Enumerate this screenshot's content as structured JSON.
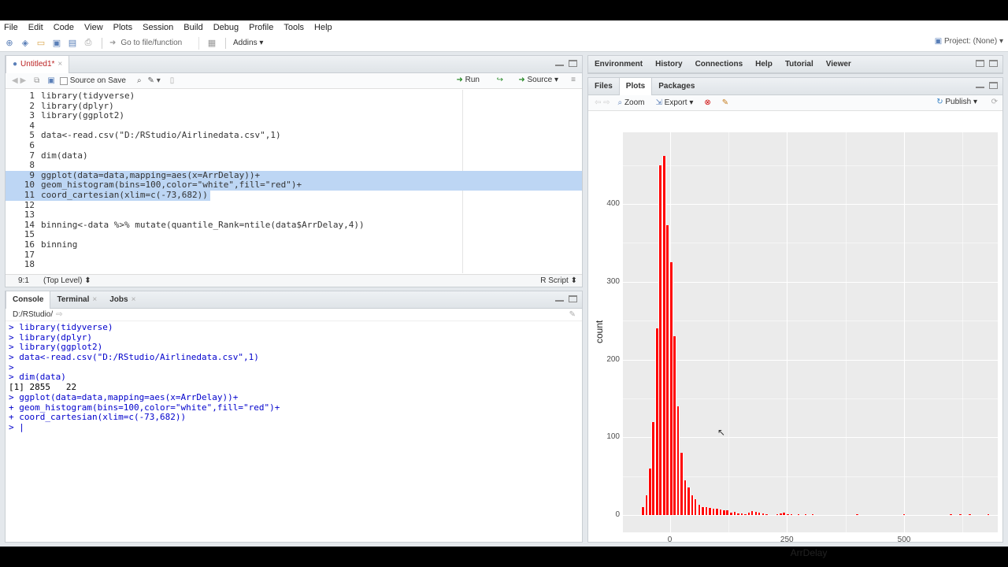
{
  "menu": [
    "File",
    "Edit",
    "Code",
    "View",
    "Plots",
    "Session",
    "Build",
    "Debug",
    "Profile",
    "Tools",
    "Help"
  ],
  "toolbar": {
    "goto_placeholder": "Go to file/function",
    "addins": "Addins",
    "project": "Project: (None)"
  },
  "source": {
    "tab_label": "Untitled1*",
    "source_on_save": "Source on Save",
    "run": "Run",
    "source": "Source",
    "cursor_pos": "9:1",
    "scope": "(Top Level)",
    "file_type": "R Script",
    "lines": [
      {
        "n": "1",
        "text": "library(tidyverse)"
      },
      {
        "n": "2",
        "text": "library(dplyr)"
      },
      {
        "n": "3",
        "text": "library(ggplot2)"
      },
      {
        "n": "4",
        "text": ""
      },
      {
        "n": "5",
        "text": "data<-read.csv(\"D:/RStudio/Airlinedata.csv\",1)"
      },
      {
        "n": "6",
        "text": ""
      },
      {
        "n": "7",
        "text": "dim(data)"
      },
      {
        "n": "8",
        "text": ""
      },
      {
        "n": "9",
        "text": "ggplot(data=data,mapping=aes(x=ArrDelay))+"
      },
      {
        "n": "10",
        "text": "geom_histogram(bins=100,color=\"white\",fill=\"red\")+"
      },
      {
        "n": "11",
        "text": "coord_cartesian(xlim=c(-73,682))"
      },
      {
        "n": "12",
        "text": ""
      },
      {
        "n": "13",
        "text": ""
      },
      {
        "n": "14",
        "text": "binning<-data %>% mutate(quantile_Rank=ntile(data$ArrDelay,4))"
      },
      {
        "n": "15",
        "text": ""
      },
      {
        "n": "16",
        "text": "binning"
      },
      {
        "n": "17",
        "text": ""
      },
      {
        "n": "18",
        "text": ""
      }
    ]
  },
  "console": {
    "tabs": [
      "Console",
      "Terminal",
      "Jobs"
    ],
    "path": "D:/RStudio/",
    "lines": [
      {
        "text": "> library(tidyverse)",
        "kind": "cmd"
      },
      {
        "text": "> library(dplyr)",
        "kind": "cmd"
      },
      {
        "text": "> library(ggplot2)",
        "kind": "cmd"
      },
      {
        "text": "> data<-read.csv(\"D:/RStudio/Airlinedata.csv\",1)",
        "kind": "cmd"
      },
      {
        "text": ">",
        "kind": "cmd"
      },
      {
        "text": "> dim(data)",
        "kind": "cmd"
      },
      {
        "text": "[1] 2855   22",
        "kind": "out"
      },
      {
        "text": "> ggplot(data=data,mapping=aes(x=ArrDelay))+",
        "kind": "cmd"
      },
      {
        "text": "+ geom_histogram(bins=100,color=\"white\",fill=\"red\")+",
        "kind": "cmd"
      },
      {
        "text": "+ coord_cartesian(xlim=c(-73,682))",
        "kind": "cmd"
      },
      {
        "text": "> |",
        "kind": "cmd"
      }
    ]
  },
  "env_tabs": [
    "Environment",
    "History",
    "Connections",
    "Help",
    "Tutorial",
    "Viewer"
  ],
  "files_tabs": [
    "Files",
    "Plots",
    "Packages"
  ],
  "plots_toolbar": {
    "zoom": "Zoom",
    "export": "Export",
    "publish": "Publish"
  },
  "chart_data": {
    "type": "bar",
    "xlabel": "ArrDelay",
    "ylabel": "count",
    "xlim": [
      -100,
      700
    ],
    "ylim": [
      0,
      470
    ],
    "x_ticks": [
      "0",
      "250",
      "500"
    ],
    "y_ticks": [
      "0",
      "100",
      "200",
      "300",
      "400"
    ],
    "bar_color": "#ff0000",
    "bar_width": 7.55,
    "x": [
      -57,
      -50,
      -42,
      -35,
      -27,
      -20,
      -12,
      -5,
      3,
      10,
      18,
      25,
      33,
      40,
      48,
      55,
      63,
      71,
      78,
      86,
      93,
      101,
      108,
      116,
      123,
      131,
      139,
      146,
      154,
      161,
      169,
      176,
      184,
      191,
      199,
      207,
      214,
      222,
      229,
      237,
      244,
      252,
      260,
      275,
      290,
      305,
      350,
      400,
      450,
      500,
      550,
      600,
      620,
      640,
      680
    ],
    "values": [
      10,
      25,
      60,
      120,
      240,
      450,
      462,
      373,
      325,
      230,
      140,
      80,
      45,
      35,
      25,
      20,
      13,
      10,
      10,
      9,
      8,
      8,
      7,
      6,
      6,
      3,
      4,
      2,
      2,
      1,
      3,
      5,
      4,
      3,
      2,
      1,
      0,
      0,
      1,
      2,
      3,
      1,
      1,
      1,
      1,
      1,
      0,
      1,
      0,
      1,
      0,
      1,
      1,
      1,
      1
    ]
  }
}
